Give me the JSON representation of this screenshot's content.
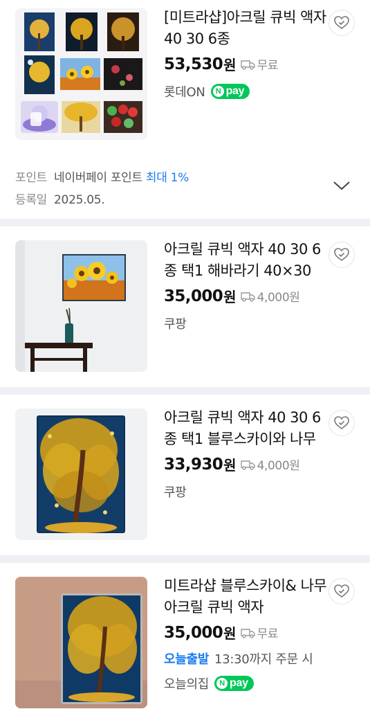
{
  "products": [
    {
      "title": "[미트라샵]아크릴 큐빅 액자 40 30 6종",
      "price": "53,530",
      "won": "원",
      "shipping": "무료",
      "seller": "롯데ON",
      "npay": true
    },
    {
      "title": "아크릴 큐빅 액자 40 30 6종 택1 해바라기 40×30",
      "price": "35,000",
      "won": "원",
      "shipping": "4,000원",
      "seller": "쿠팡",
      "npay": false
    },
    {
      "title": "아크릴 큐빅 액자 40 30 6종 택1 블루스카이와 나무",
      "price": "33,930",
      "won": "원",
      "shipping": "4,000원",
      "seller": "쿠팡",
      "npay": false
    },
    {
      "title": "미트라샵 블루스카이& 나무 아크릴 큐빅 액자",
      "price": "35,000",
      "won": "원",
      "shipping": "무료",
      "today_label": "오늘출발",
      "today_text": "13:30까지 주문 시",
      "seller": "오늘의집",
      "npay": true
    }
  ],
  "points": {
    "label": "포인트",
    "text": "네이버페이 포인트",
    "highlight": "최대 1%",
    "date_label": "등록일",
    "date_value": "2025.05."
  },
  "npay_label": "pay",
  "npay_letter": "N",
  "icons": {
    "favorite": "heart-check-icon",
    "shipping": "truck-icon",
    "expand": "chevron-down-icon"
  },
  "colors": {
    "accent_blue": "#1b7cf1",
    "npay_green": "#03c75a",
    "divider": "#eef0f4"
  }
}
